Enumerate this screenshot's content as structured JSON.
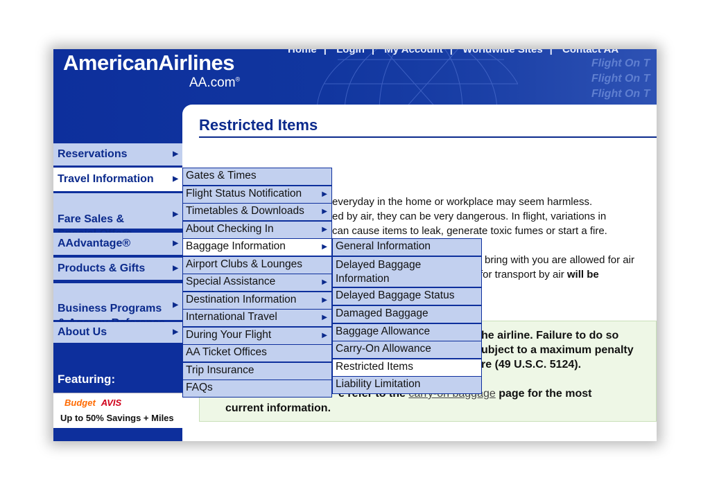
{
  "header": {
    "logo_main": "AmericanAirlines",
    "logo_sub": "AA.com",
    "top_nav": [
      "Home",
      "Login",
      "My Account",
      "Worldwide Sites",
      "Contact AA"
    ],
    "tagline": [
      "Flight On T",
      "Flight On T",
      "Flight On T"
    ]
  },
  "main_nav": [
    {
      "label": "Reservations"
    },
    {
      "label": "Travel Information"
    },
    {
      "label": "Fare Sales &\nSpecial Offers"
    },
    {
      "label": "AAdvantage®"
    },
    {
      "label": "Products & Gifts"
    },
    {
      "label": "Business Programs\n& Agency Reference"
    },
    {
      "label": "About Us"
    }
  ],
  "featuring": {
    "title": "Featuring:",
    "budget": "Budget",
    "avis": "AVIS",
    "text": "Up to 50% Savings + Miles"
  },
  "content": {
    "title": "Restricted Items",
    "paragraph1": [
      "everyday in the home or workplace may seem harmless.",
      "ed by air, they can be very dangerous. In flight, variations in",
      "can cause items to leak, generate toxic fumes or start a fire."
    ],
    "paragraph2": [
      "bring with you are allowed for air",
      "for transport by air ",
      "will be"
    ],
    "notice": [
      "he airline. Failure to do so",
      "ubject to a maximum penalty",
      "re (49 U.S.C. 5124)."
    ],
    "notice_prefix": "e refer to the ",
    "notice_link": "carry-on baggage",
    "notice_suffix": " page for the most",
    "notice_last": "current information."
  },
  "travel_menu": [
    {
      "label": "Gates & Times",
      "arrow": false
    },
    {
      "label": "Flight Status Notification",
      "arrow": true
    },
    {
      "label": "Timetables & Downloads",
      "arrow": true
    },
    {
      "label": "About Checking In",
      "arrow": true
    },
    {
      "label": "Baggage Information",
      "arrow": true
    },
    {
      "label": "Airport Clubs & Lounges",
      "arrow": false
    },
    {
      "label": "Special Assistance",
      "arrow": true
    },
    {
      "label": "Destination Information",
      "arrow": true
    },
    {
      "label": "International Travel",
      "arrow": true
    },
    {
      "label": "During Your Flight",
      "arrow": true
    },
    {
      "label": "AA Ticket Offices",
      "arrow": false
    },
    {
      "label": "Trip Insurance",
      "arrow": false
    },
    {
      "label": "FAQs",
      "arrow": false
    }
  ],
  "baggage_menu": [
    {
      "label": "General Information"
    },
    {
      "label": "Delayed Baggage\nInformation"
    },
    {
      "label": "Delayed Baggage Status"
    },
    {
      "label": "Damaged Baggage"
    },
    {
      "label": "Baggage Allowance"
    },
    {
      "label": "Carry-On Allowance"
    },
    {
      "label": "Restricted Items"
    },
    {
      "label": "Liability Limitation"
    }
  ],
  "colors": {
    "brand_blue": "#0d2f9c",
    "menu_bg": "#c2d0ef",
    "title_blue": "#0b2a8c",
    "notice_bg": "#eef7e6"
  }
}
